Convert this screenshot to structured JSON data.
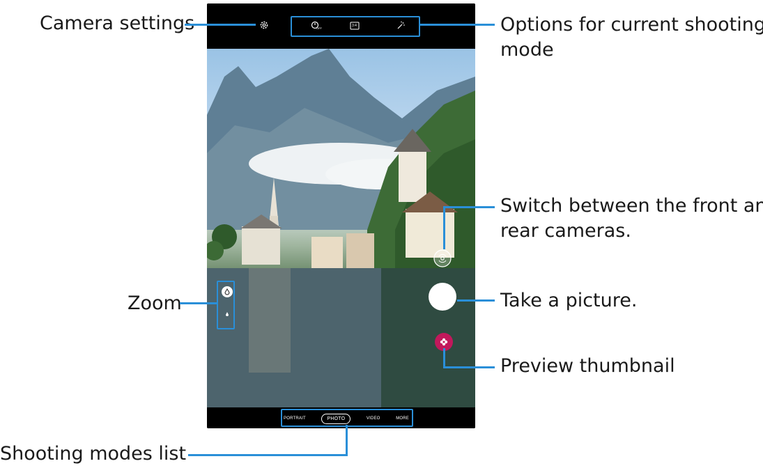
{
  "callouts": {
    "camera_settings": "Camera settings",
    "options_line1": "Options for current shooting",
    "options_line2": "mode",
    "switch_line1": "Switch between the front and",
    "switch_line2": "rear cameras.",
    "zoom": "Zoom",
    "take_picture": "Take a picture.",
    "preview_thumbnail": "Preview thumbnail",
    "shooting_modes_list": "Shooting modes list"
  },
  "camera": {
    "top_controls": [
      {
        "icon": "timer-off-icon",
        "text": "OFF"
      },
      {
        "icon": "aspect-ratio-icon",
        "text": "3:4"
      },
      {
        "icon": "filter-sparkle-icon",
        "text": ""
      }
    ],
    "modes": [
      "PORTRAIT",
      "PHOTO",
      "VIDEO",
      "MORE"
    ],
    "active_mode": "PHOTO"
  },
  "colors": {
    "callout_blue": "#2a8fd8",
    "thumbnail_pink": "#c2185b",
    "screen_black": "#000000"
  }
}
